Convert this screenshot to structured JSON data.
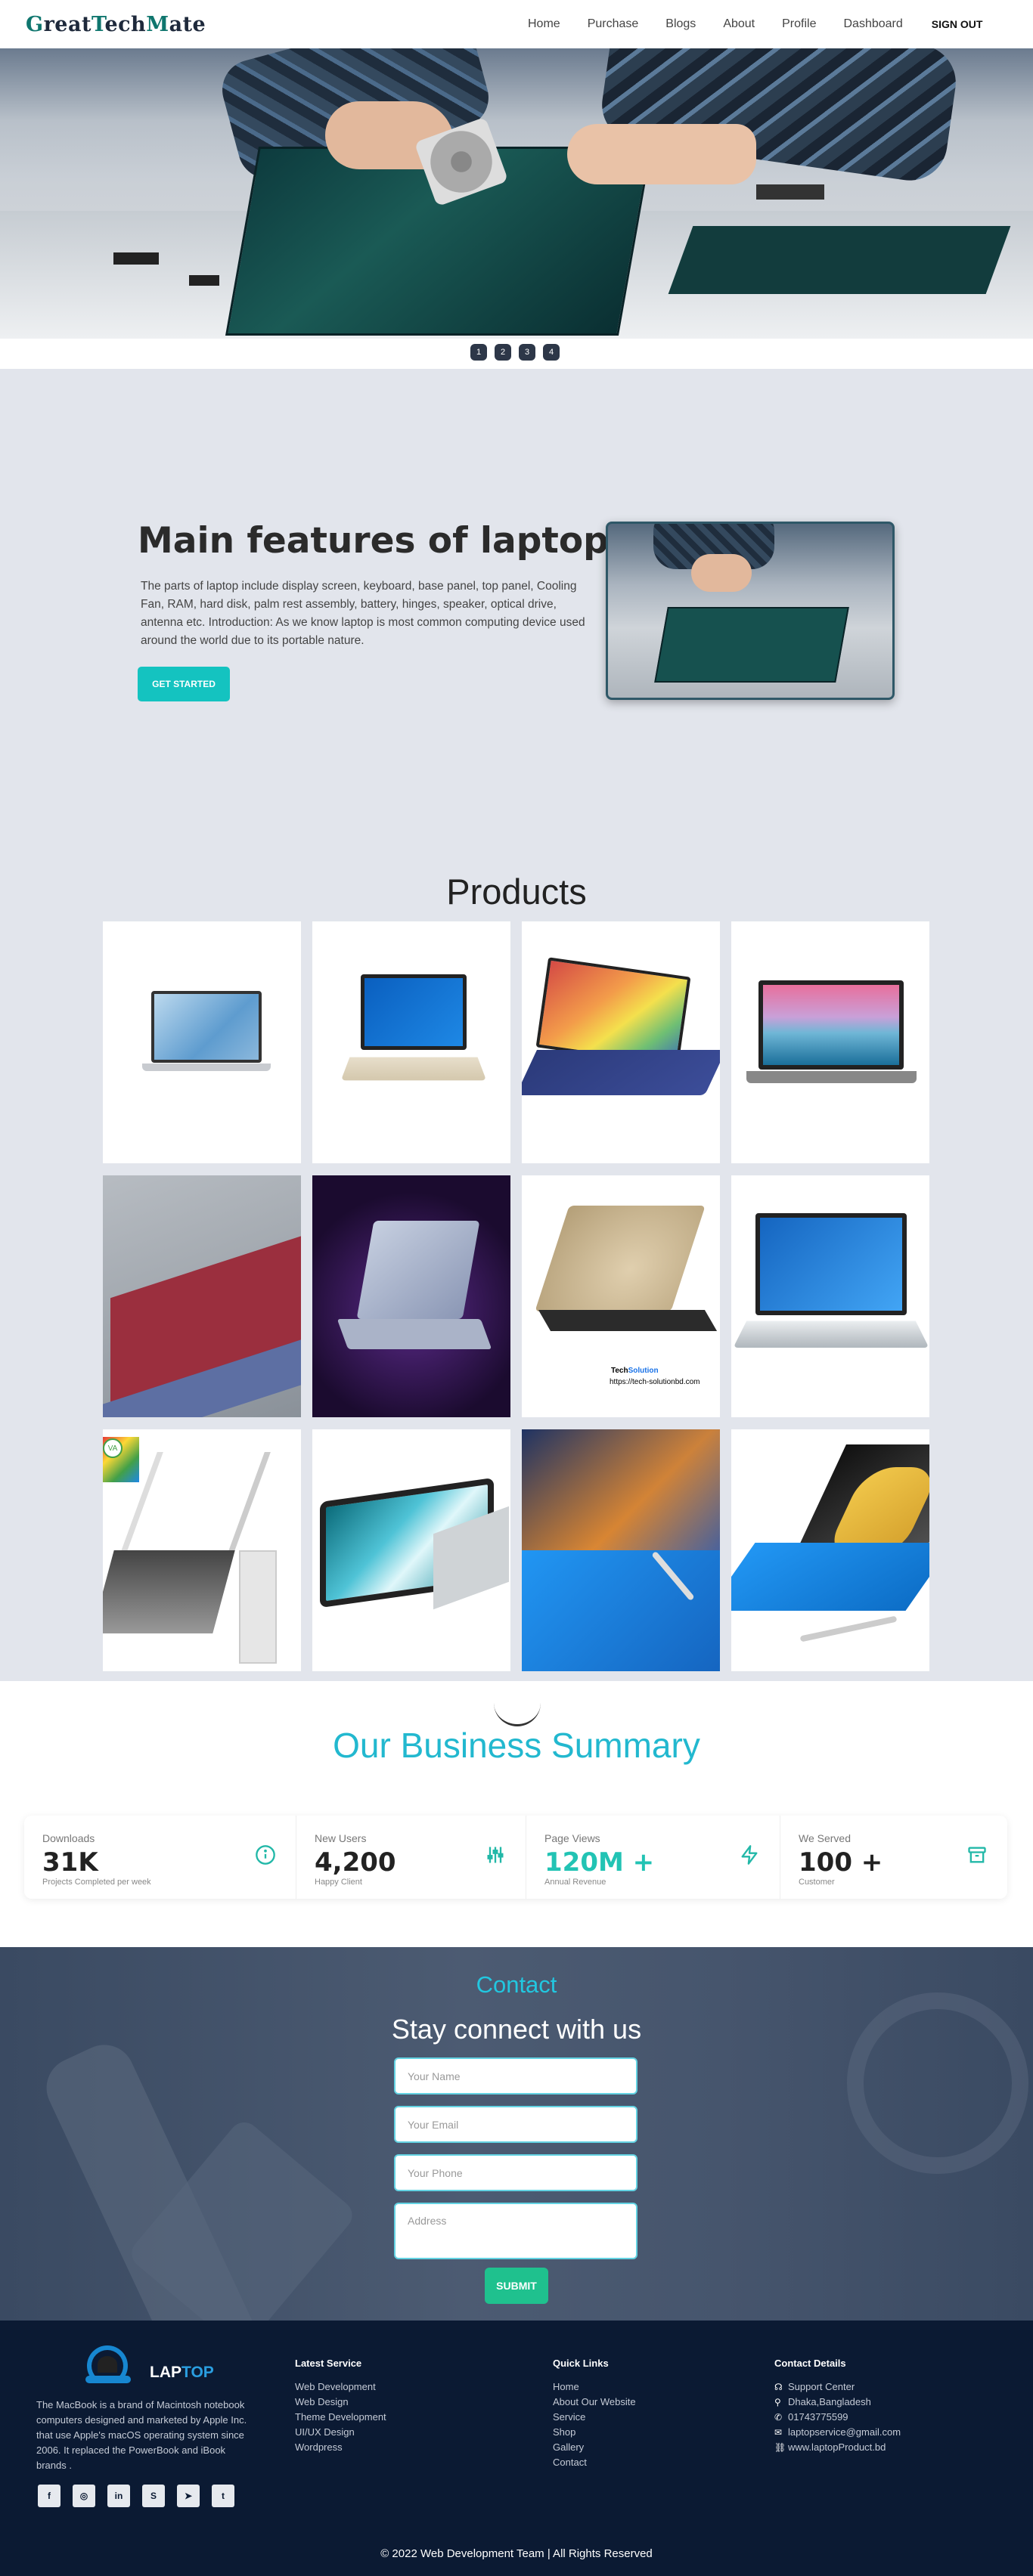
{
  "brand": {
    "part1": "G",
    "part2": "reat",
    "part3": "T",
    "part4": "ech",
    "part5": "M",
    "part6": "ate"
  },
  "nav": {
    "items": [
      "Home",
      "Purchase",
      "Blogs",
      "About",
      "Profile",
      "Dashboard"
    ],
    "signout": "SIGN OUT"
  },
  "slider": {
    "dots": [
      "1",
      "2",
      "3",
      "4"
    ]
  },
  "features": {
    "title": "Main features of laptop",
    "text": "The parts of laptop include display screen, keyboard, base panel, top panel, Cooling Fan, RAM, hard disk, palm rest assembly, battery, hinges, speaker, optical drive, antenna etc. Introduction: As we know laptop is most common computing device used around the world due to its portable nature.",
    "button": "GET STARTED"
  },
  "products": {
    "title": "Products",
    "watermark": "https://tech-solutionbd.com"
  },
  "summary": {
    "title": "Our Business Summary",
    "stats": [
      {
        "label": "Downloads",
        "value": "31K",
        "sub": "Projects Completed per week",
        "icon": "info-icon"
      },
      {
        "label": "New Users",
        "value": "4,200",
        "sub": "Happy Client",
        "icon": "sliders-icon"
      },
      {
        "label": "Page Views",
        "value": "120M +",
        "sub": "Annual Revenue",
        "icon": "bolt-icon"
      },
      {
        "label": "We Served",
        "value": "100 +",
        "sub": "Customer",
        "icon": "archive-icon"
      }
    ]
  },
  "contact": {
    "tag": "Contact",
    "title": "Stay connect with us",
    "name_placeholder": "Your Name",
    "email_placeholder": "Your Email",
    "phone_placeholder": "Your Phone",
    "address_placeholder": "Address",
    "submit": "SUBMIT"
  },
  "footer": {
    "brand1": "LAP",
    "brand2": "TOP",
    "desc": "The MacBook is a brand of Macintosh notebook computers designed and marketed by Apple Inc. that use Apple's macOS operating system since 2006. It replaced the PowerBook and iBook brands .",
    "services_title": "Latest Service",
    "services": [
      "Web Development",
      "Web Design",
      "Theme Development",
      "UI/UX Design",
      "Wordpress"
    ],
    "links_title": "Quick Links",
    "links": [
      "Home",
      "About Our Website",
      "Service",
      "Shop",
      "Gallery",
      "Contact"
    ],
    "contact_title": "Contact Details",
    "contacts": [
      "Support Center",
      "Dhaka,Bangladesh",
      "01743775599",
      "laptopservice@gmail.com",
      "www.laptopProduct.bd"
    ],
    "copyright": "© 2022 Web Development Team | All Rights Reserved"
  }
}
